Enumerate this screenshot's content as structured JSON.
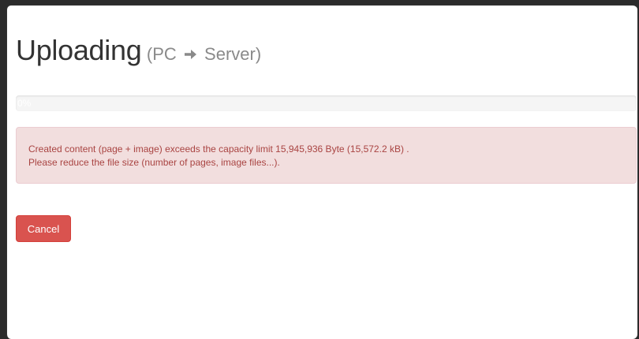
{
  "dialog": {
    "title": "Uploading",
    "subtitle_open": "(PC",
    "subtitle_close": "Server)",
    "arrow_icon": "arrow-right-icon"
  },
  "progress": {
    "percent_label": "0%",
    "value": 0,
    "bar_color": "#337ab7"
  },
  "alert": {
    "line1": "Created content (page + image) exceeds the capacity limit 15,945,936 Byte (15,572.2 kB) .",
    "line2": "Please reduce the file size (number of pages, image files...).",
    "text_color": "#a94442",
    "background": "#f2dede"
  },
  "actions": {
    "cancel_label": "Cancel",
    "cancel_color": "#d9534f"
  }
}
